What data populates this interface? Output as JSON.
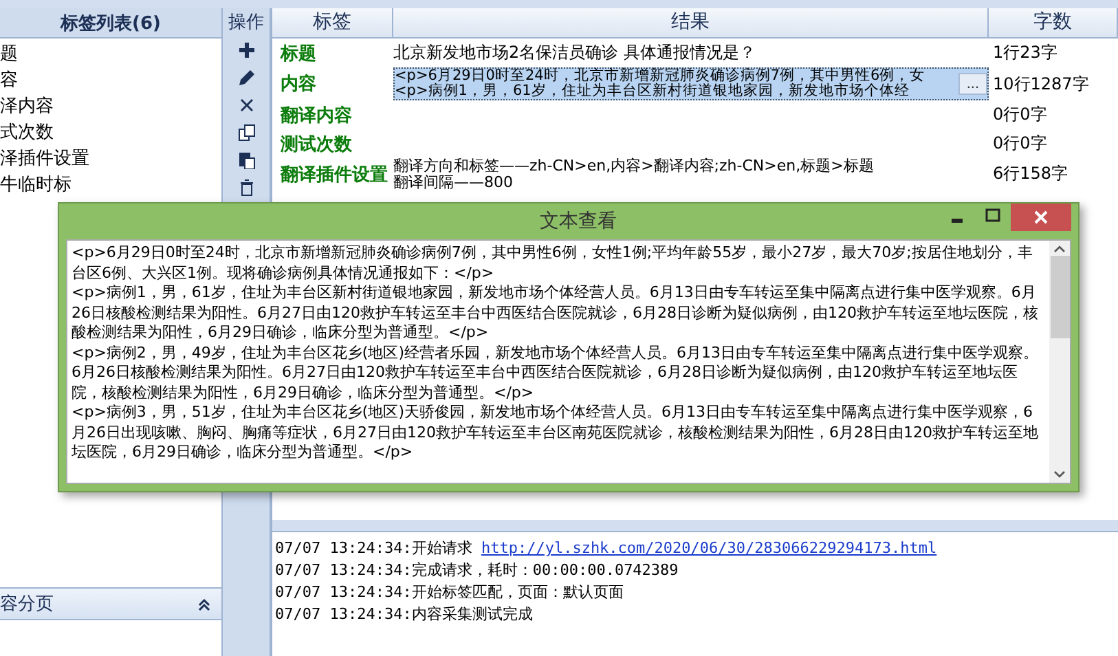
{
  "tag_list": {
    "title": "标签列表(6)",
    "items": [
      {
        "label": "题"
      },
      {
        "label": "容"
      },
      {
        "label": "泽内容"
      },
      {
        "label": "式次数"
      },
      {
        "label": "泽插件设置"
      },
      {
        "label": "牛临时标"
      }
    ]
  },
  "toolbar": {
    "title": "操作",
    "tools": [
      {
        "kind": "add"
      },
      {
        "kind": "edit"
      },
      {
        "kind": "delete"
      },
      {
        "kind": "copy"
      },
      {
        "kind": "paste"
      },
      {
        "kind": "trash"
      }
    ]
  },
  "table": {
    "columns": [
      "标签",
      "结果",
      "字数"
    ],
    "cell_button": "...",
    "rows": [
      {
        "tag": "标题",
        "result": "北京新发地市场2名保洁员确诊 具体通报情况是？",
        "count": "1行23字",
        "selected": false
      },
      {
        "tag": "内容",
        "result": "<p>6月29日0时至24时，北京市新增新冠肺炎确诊病例7例，其中男性6例，女<p>病例1，男，61岁，住址为丰台区新村街道银地家园，新发地市场个体经",
        "count": "10行1287字",
        "selected": true
      },
      {
        "tag": "翻译内容",
        "count": "0行0字",
        "selected": false
      },
      {
        "tag": "测试次数",
        "count": "0行0字",
        "selected": false
      },
      {
        "tag": "翻译插件设置",
        "result": "翻译方向和标签——zh-CN>en,内容>翻译内容;zh-CN>en,标题>标题",
        "result_line_2": "翻译间隔——800",
        "count": "6行158字",
        "selected": false
      }
    ]
  },
  "section": {
    "title": "容分页",
    "expanded": true
  },
  "log": [
    {
      "text": "07/07 13:24:34:开始请求",
      "link": "http://yl.szhk.com/2020/06/30/283066229294173.html"
    },
    {
      "text": "07/07 13:24:34:完成请求，耗时：00:00:00.0742389"
    },
    {
      "text": "07/07 13:24:34:开始标签匹配，页面：默认页面"
    },
    {
      "text": "07/07 13:24:34:内容采集测试完成"
    }
  ],
  "dialog": {
    "title": "文本查看",
    "paragraphs": [
      "<p>6月29日0时至24时，北京市新增新冠肺炎确诊病例7例，其中男性6例，女性1例;平均年龄55岁，最小27岁，最大70岁;按居住地划分，丰台区6例、大兴区1例。现将确诊病例具体情况通报如下：</p>",
      "<p>病例1，男，61岁，住址为丰台区新村街道银地家园，新发地市场个体经营人员。6月13日由专车转运至集中隔离点进行集中医学观察。6月26日核酸检测结果为阳性。6月27日由120救护车转运至丰台中西医结合医院就诊，6月28日诊断为疑似病例，由120救护车转运至地坛医院，核酸检测结果为阳性，6月29日确诊，临床分型为普通型。</p>",
      "<p>病例2，男，49岁，住址为丰台区花乡(地区)经营者乐园，新发地市场个体经营人员。6月13日由专车转运至集中隔离点进行集中医学观察。6月26日核酸检测结果为阳性。6月27日由120救护车转运至丰台中西医结合医院就诊，6月28日诊断为疑似病例，由120救护车转运至地坛医院，核酸检测结果为阳性，6月29日确诊，临床分型为普通型。</p>",
      "<p>病例3，男，51岁，住址为丰台区花乡(地区)天骄俊园，新发地市场个体经营人员。6月13日由专车转运至集中隔离点进行集中医学观察，6月26日出现咳嗽、胸闷、胸痛等症状，6月27日由120救护车转运至丰台区南苑医院就诊，核酸检测结果为阳性，6月28日由120救护车转运至地坛医院，6月29日确诊，临床分型为普通型。</p>"
    ]
  }
}
